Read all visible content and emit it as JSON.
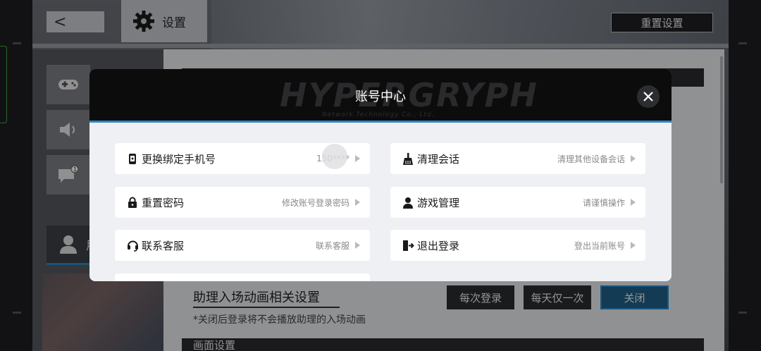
{
  "header": {
    "back_glyph": "<",
    "title": "设置",
    "reset_label": "重置设置"
  },
  "sidebar": {
    "user_label": "用"
  },
  "background": {
    "assist_title": "助理入场动画相关设置",
    "assist_note": "*关闭后登录将不会播放助理的入场动画",
    "options": [
      "每次登录",
      "每天仅一次",
      "关闭"
    ],
    "screen_section": "画面设置"
  },
  "modal": {
    "title": "账号中心",
    "watermark": "HYPERGRYPH",
    "watermark_sub": "Network Technology Co., Ltd.",
    "items": [
      {
        "label": "更换绑定手机号",
        "value": "150****",
        "icon": "phone-icon"
      },
      {
        "label": "清理会话",
        "value": "清理其他设备会话",
        "icon": "broom-icon"
      },
      {
        "label": "重置密码",
        "value": "修改账号登录密码",
        "icon": "lock-icon"
      },
      {
        "label": "游戏管理",
        "value": "请谨慎操作",
        "icon": "user-icon"
      },
      {
        "label": "联系客服",
        "value": "联系客服",
        "icon": "headset-icon"
      },
      {
        "label": "退出登录",
        "value": "登出当前账号",
        "icon": "logout-icon"
      }
    ]
  },
  "colors": {
    "accent": "#2a87c0",
    "modal_header": "#0c0c0d",
    "active_option": "#1f5f87"
  }
}
